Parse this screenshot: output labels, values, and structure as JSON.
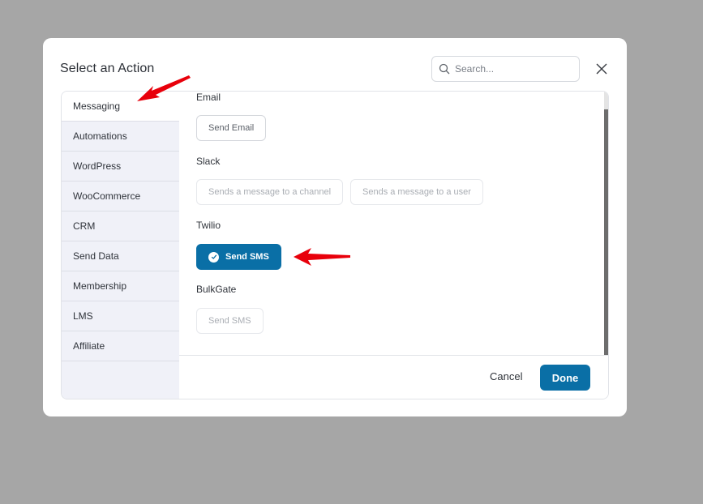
{
  "modal": {
    "title": "Select an Action",
    "search": {
      "placeholder": "Search...",
      "value": ""
    },
    "close_icon": "close-icon"
  },
  "sidebar": {
    "items": [
      {
        "label": "Messaging",
        "active": true
      },
      {
        "label": "Automations",
        "active": false
      },
      {
        "label": "WordPress",
        "active": false
      },
      {
        "label": "WooCommerce",
        "active": false
      },
      {
        "label": "CRM",
        "active": false
      },
      {
        "label": "Send Data",
        "active": false
      },
      {
        "label": "Membership",
        "active": false
      },
      {
        "label": "LMS",
        "active": false
      },
      {
        "label": "Affiliate",
        "active": false
      }
    ]
  },
  "groups": [
    {
      "label": "Email",
      "actions": [
        {
          "label": "Send Email",
          "state": "enabled"
        }
      ]
    },
    {
      "label": "Slack",
      "actions": [
        {
          "label": "Sends a message to a channel",
          "state": "disabled"
        },
        {
          "label": "Sends a message to a user",
          "state": "disabled"
        }
      ]
    },
    {
      "label": "Twilio",
      "actions": [
        {
          "label": "Send SMS",
          "state": "selected"
        }
      ]
    },
    {
      "label": "BulkGate",
      "actions": [
        {
          "label": "Send SMS",
          "state": "disabled"
        }
      ]
    }
  ],
  "footer": {
    "cancel_label": "Cancel",
    "done_label": "Done"
  },
  "colors": {
    "accent": "#0a6fa6",
    "annotation_arrow": "#e8000b",
    "overlay": "#a6a6a6",
    "sidebar_bg": "#f0f1f8"
  }
}
